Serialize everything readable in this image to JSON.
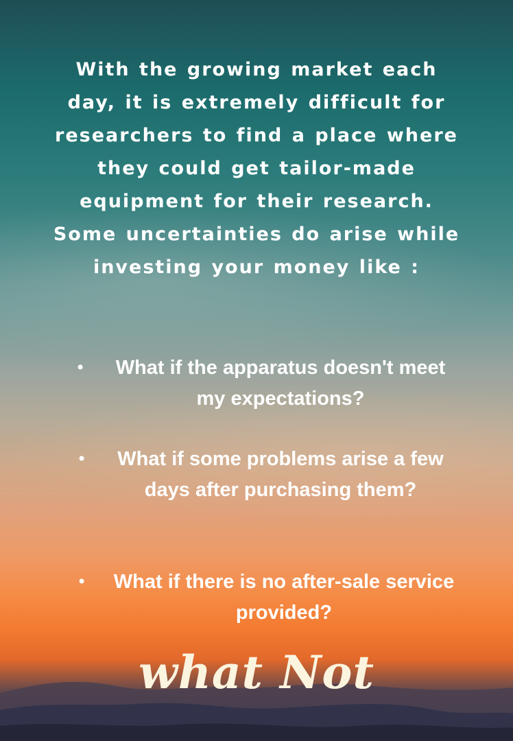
{
  "intro_text": "With the growing market each day, it is extremely difficult for researchers to find a place where they could get tailor-made equipment for their research.  Some uncertainties do arise while investing your money like :",
  "questions": [
    {
      "bullet": "•",
      "text": "What if the apparatus doesn't meet my expectations?"
    },
    {
      "bullet": "•",
      "text": "What if some problems arise a few days after purchasing them?"
    },
    {
      "bullet": "•",
      "text": "What if there is no after-sale service provided?"
    }
  ],
  "closing": "what Not",
  "colors": {
    "sky_top": "#1f4e55",
    "sky_middle": "#9aa5a0",
    "sunset_orange": "#f47a30",
    "hills": "#2b2f42",
    "text": "#ffffff",
    "closing_text": "#fbf4df"
  }
}
